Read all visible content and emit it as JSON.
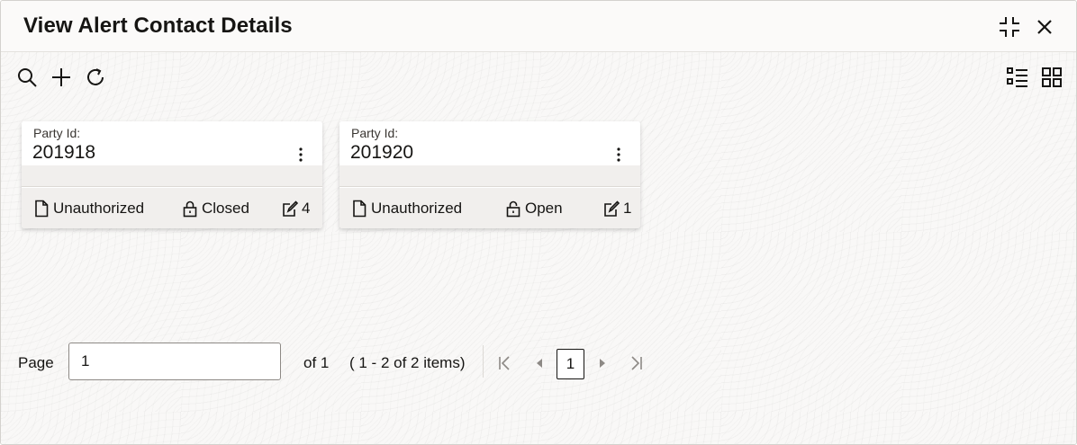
{
  "window": {
    "title": "View Alert Contact Details"
  },
  "titlebar": {
    "minimize_icon": "compress-icon",
    "close_icon": "close-icon"
  },
  "toolbar": {
    "search_icon": "search-icon",
    "add_icon": "plus-icon",
    "refresh_icon": "refresh-icon",
    "list_view_icon": "list-view-icon",
    "grid_view_icon": "grid-view-icon"
  },
  "cards": [
    {
      "label": "Party Id:",
      "value": "201918",
      "status": "Unauthorized",
      "lock_state": "Closed",
      "edit_count": "4"
    },
    {
      "label": "Party Id:",
      "value": "201920",
      "status": "Unauthorized",
      "lock_state": "Open",
      "edit_count": "1"
    }
  ],
  "pagination": {
    "page_label": "Page",
    "page_value": "1",
    "of_text": "of 1",
    "range_text": "( 1 - 2 of 2 items)",
    "current_page": "1"
  }
}
